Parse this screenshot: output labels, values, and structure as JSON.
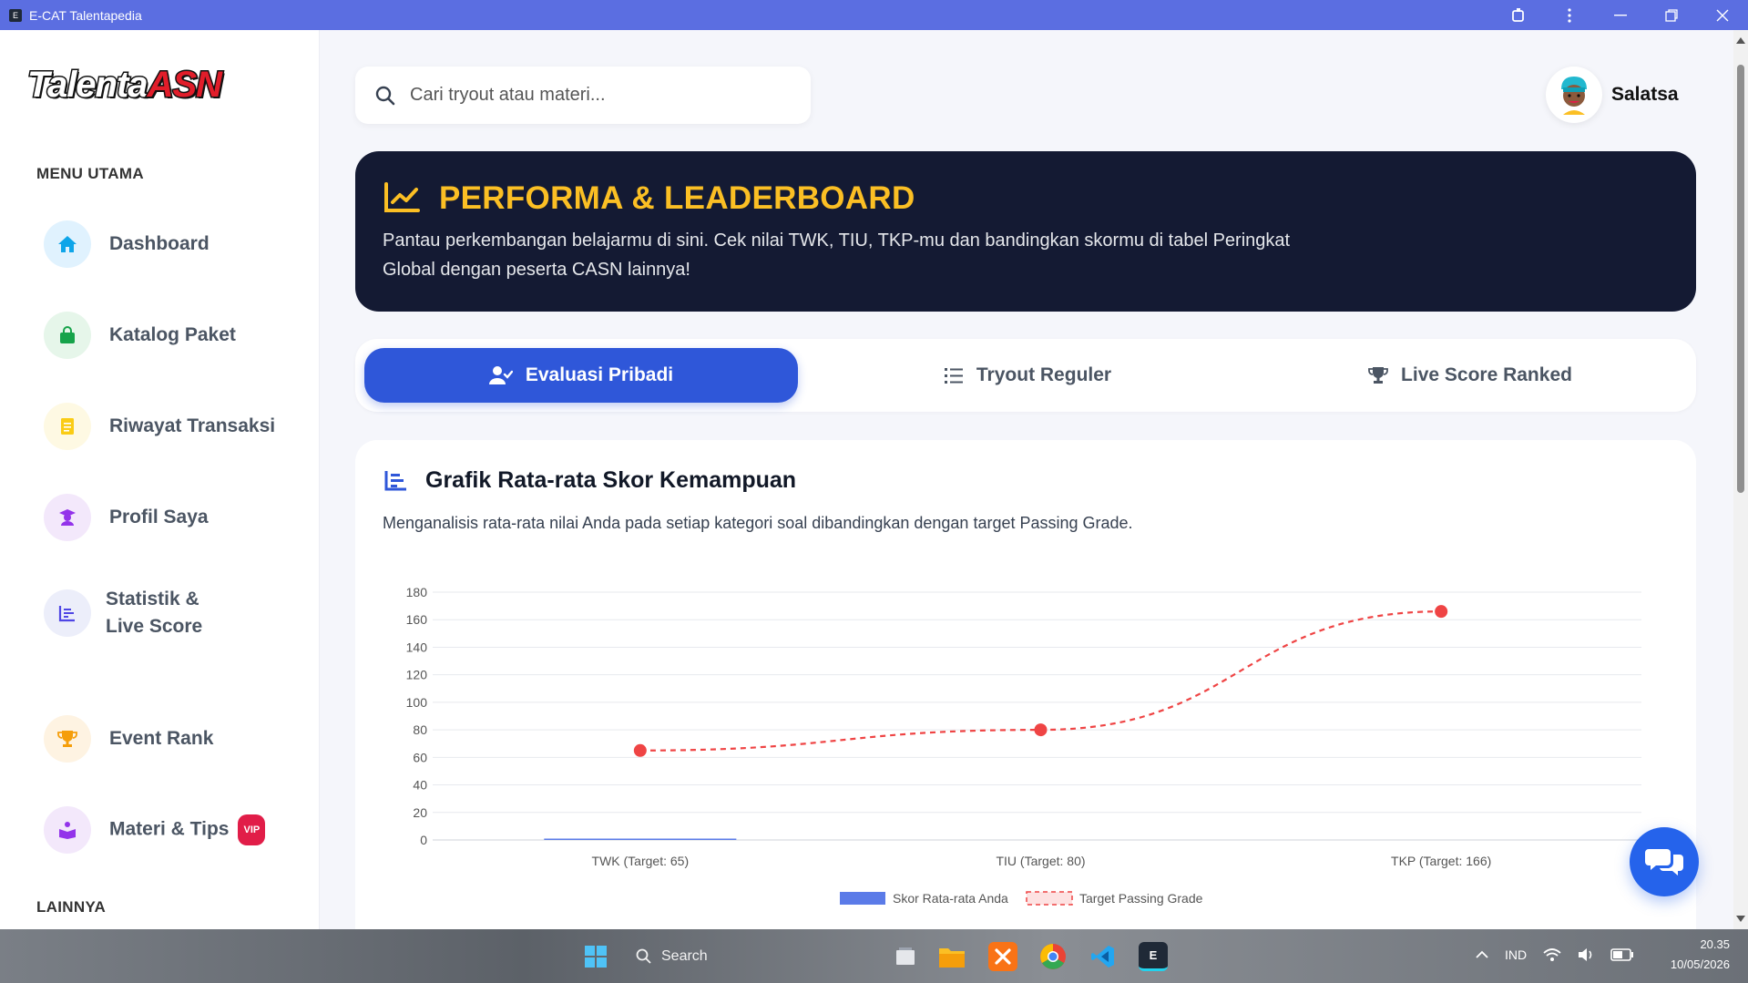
{
  "window": {
    "title": "E-CAT Talentapedia",
    "app_icon": "E"
  },
  "logo": {
    "part1": "Talenta",
    "part2": "ASN"
  },
  "sidebar": {
    "main_heading": "MENU UTAMA",
    "other_heading": "LAINNYA",
    "items": [
      {
        "label": "Dashboard",
        "icon": "home-icon",
        "color": "#0ea5e9",
        "bg": "#e0f2fe"
      },
      {
        "label": "Katalog Paket",
        "icon": "shopping-bag-icon",
        "color": "#16a34a",
        "bg": "#e6f6ea"
      },
      {
        "label": "Riwayat Transaksi",
        "icon": "receipt-icon",
        "color": "#facc15",
        "bg": "#fef9e3"
      },
      {
        "label": "Profil Saya",
        "icon": "user-graduate-icon",
        "color": "#9333ea",
        "bg": "#f3e8fb"
      },
      {
        "label": "Statistik & Live Score",
        "icon": "chart-bar-icon",
        "color": "#4f46e5",
        "bg": "#eceefa"
      },
      {
        "label": "Event Rank",
        "icon": "trophy-icon",
        "color": "#f59e0b",
        "bg": "#fef3e2"
      },
      {
        "label": "Materi & Tips",
        "icon": "book-reader-icon",
        "color": "#9333ea",
        "bg": "#f3e8fb",
        "badge": "VIP"
      }
    ]
  },
  "search": {
    "placeholder": "Cari tryout atau materi..."
  },
  "user": {
    "name": "Salatsa"
  },
  "hero": {
    "title": "PERFORMA & LEADERBOARD",
    "description": "Pantau perkembangan belajarmu di sini. Cek nilai TWK, TIU, TKP-mu dan bandingkan skormu di tabel Peringkat Global dengan peserta CASN lainnya!"
  },
  "tabs": [
    {
      "label": "Evaluasi Pribadi",
      "active": true
    },
    {
      "label": "Tryout Reguler",
      "active": false
    },
    {
      "label": "Live Score Ranked",
      "active": false
    }
  ],
  "card": {
    "title": "Grafik Rata-rata Skor Kemampuan",
    "description": "Menganalisis rata-rata nilai Anda pada setiap kategori soal dibandingkan dengan target Passing Grade."
  },
  "chart_data": {
    "type": "bar",
    "categories": [
      "TWK (Target: 65)",
      "TIU (Target: 80)",
      "TKP (Target: 166)"
    ],
    "series": [
      {
        "name": "Skor Rata-rata Anda",
        "type": "bar",
        "values": [
          1,
          0,
          0
        ],
        "color": "#5b7be8"
      },
      {
        "name": "Target Passing Grade",
        "type": "line-dashed",
        "values": [
          65,
          80,
          166
        ],
        "color": "#ef4444"
      }
    ],
    "yticks": [
      0,
      20,
      40,
      60,
      80,
      100,
      120,
      140,
      160,
      180
    ],
    "ylim": [
      0,
      180
    ],
    "grid": true,
    "legend": "bottom"
  },
  "taskbar": {
    "search_label": "Search",
    "language": "IND",
    "time": "20.35",
    "date": "10/05/2026",
    "active_app": "E"
  }
}
